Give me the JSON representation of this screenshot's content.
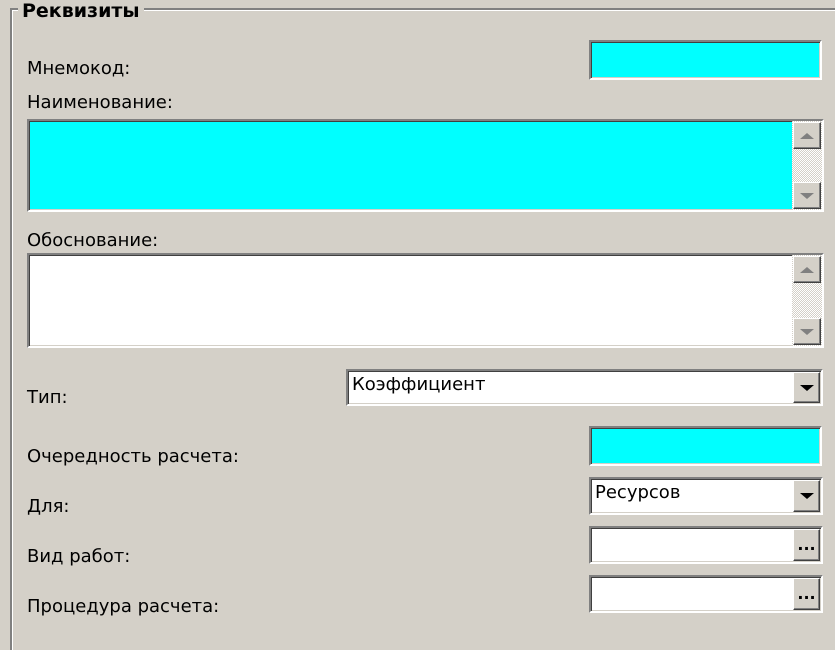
{
  "group": {
    "title": "Реквизиты"
  },
  "fields": {
    "mnemocode": {
      "label": "Мнемокод:",
      "value": ""
    },
    "name": {
      "label": "Наименование:",
      "value": ""
    },
    "justification": {
      "label": "Обоснование:",
      "value": ""
    },
    "type": {
      "label": "Тип:",
      "value": "Коэффициент"
    },
    "calc_order": {
      "label": "Очередность расчета:",
      "value": ""
    },
    "for": {
      "label": "Для:",
      "value": "Ресурсов"
    },
    "work_type": {
      "label": "Вид работ:",
      "value": "",
      "button": "..."
    },
    "calc_procedure": {
      "label": "Процедура расчета:",
      "value": "",
      "button": "..."
    }
  },
  "colors": {
    "required_field": "#00ffff",
    "window_bg": "#d4d0c8"
  }
}
